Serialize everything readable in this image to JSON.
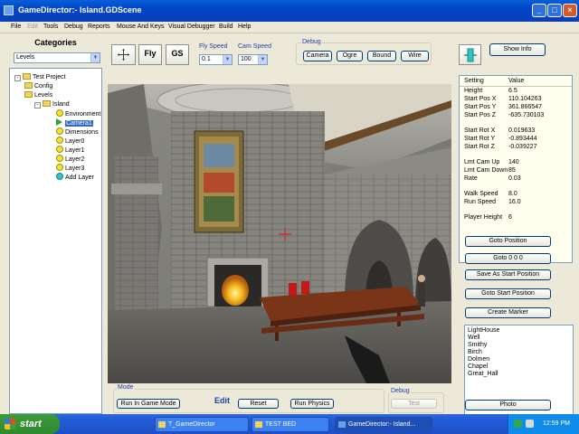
{
  "window": {
    "title": "GameDirector:- Island.GDScene"
  },
  "menu": [
    "File",
    "Edit",
    "Tools",
    "Debug",
    "Reports",
    "Mouse And Keys",
    "Visual Debugger",
    "Build",
    "Help"
  ],
  "left_panel": {
    "title": "Categories",
    "category_select": "Levels",
    "tree": [
      {
        "label": "Test Project",
        "icon": "folder-icon",
        "level": 0,
        "expander": "-"
      },
      {
        "label": "Config",
        "icon": "folder-icon",
        "level": 1
      },
      {
        "label": "Levels",
        "icon": "folder-icon",
        "level": 1,
        "expander": "-"
      },
      {
        "label": "Island",
        "icon": "folder-icon",
        "level": 2,
        "expander": "-"
      },
      {
        "label": "Environment",
        "icon": "circle-icon",
        "level": 3
      },
      {
        "label": "Camera1",
        "icon": "play-icon",
        "level": 3,
        "selected": true
      },
      {
        "label": "Dimensions",
        "icon": "circle-icon",
        "level": 3
      },
      {
        "label": "Layer0",
        "icon": "circle-icon",
        "level": 3
      },
      {
        "label": "Layer1",
        "icon": "circle-icon",
        "level": 3
      },
      {
        "label": "Layer2",
        "icon": "circle-icon",
        "level": 3
      },
      {
        "label": "Layer3",
        "icon": "circle-icon",
        "level": 3
      },
      {
        "label": "Add Layer",
        "icon": "cyan-circle-icon",
        "level": 3
      }
    ]
  },
  "toolbar": {
    "move_icon": "move-icon",
    "fly_label": "Fly",
    "gs_label": "GS",
    "fly_speed_label": "Fly Speed",
    "fly_speed_value": "0.1",
    "cam_speed_label": "Cam Speed",
    "cam_speed_value": "100",
    "debug_label": "Debug",
    "debug_buttons": [
      "Camera",
      "Ogre",
      "Bound",
      "Wire"
    ]
  },
  "right_panel": {
    "toggle_icon": "panel-toggle-icon",
    "show_info_label": "Show Info",
    "props_header": {
      "setting": "Setting",
      "value": "Value"
    },
    "props": [
      {
        "setting": "Height",
        "value": "6.5"
      },
      {
        "setting": "Start Pos X",
        "value": "110.104263"
      },
      {
        "setting": "Start Pos Y",
        "value": "361.866547"
      },
      {
        "setting": "Start Pos Z",
        "value": "-635.730103"
      },
      {
        "setting": "Start Rot X",
        "value": "0.019633"
      },
      {
        "setting": "Start Rot Y",
        "value": "-0.893444"
      },
      {
        "setting": "Start Rot Z",
        "value": "-0.039227"
      },
      {
        "setting": "Lmt Cam Up",
        "value": "140"
      },
      {
        "setting": "Lmt Cam Down",
        "value": "85"
      },
      {
        "setting": "Rate",
        "value": "0.03"
      },
      {
        "setting": "Walk Speed",
        "value": "8.0"
      },
      {
        "setting": "Run Speed",
        "value": "16.0"
      },
      {
        "setting": "Player Height",
        "value": "6"
      }
    ],
    "buttons": [
      "Goto Position",
      "Goto 0 0 0",
      "Save As Start Position",
      "Goto Start Position",
      "Create Marker"
    ],
    "markers": [
      "LightHouse",
      "Well",
      "Smithy",
      "Birch",
      "Dolmen",
      "Chapel",
      "Great_Hall"
    ],
    "photo_label": "Photo"
  },
  "bottom_bar": {
    "mode_label": "Mode",
    "run_in_game_mode": "Run In Game Mode",
    "edit_label": "Edit",
    "reset_label": "Reset",
    "run_physics_label": "Run Physics",
    "debug_label": "Debug",
    "test_label": "Test"
  },
  "taskbar": {
    "start_label": "start",
    "tasks": [
      "T_GameDirector",
      "TEST BED",
      "GameDirector:- Island..."
    ],
    "clock": "12:59 PM"
  }
}
